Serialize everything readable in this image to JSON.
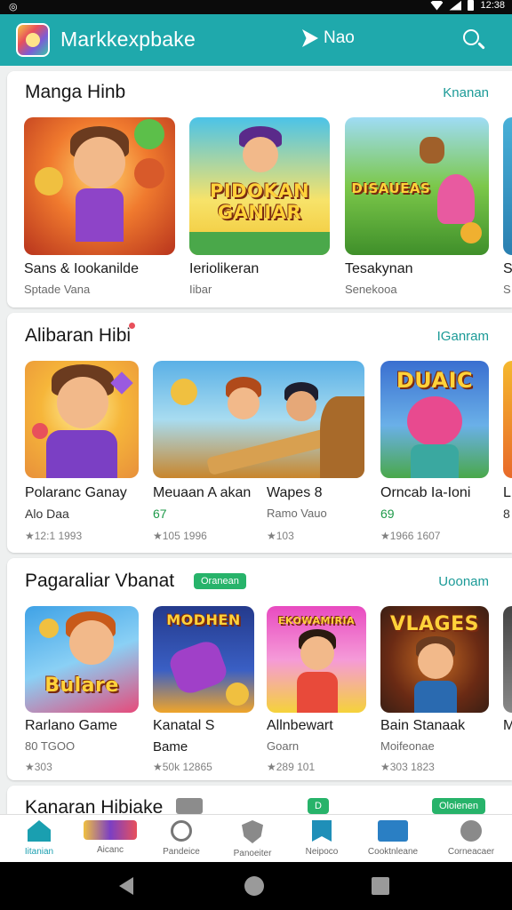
{
  "status_bar": {
    "left_icon": "settings-circle-icon",
    "time": "12:38"
  },
  "app_bar": {
    "title": "Markkexpbake",
    "now_label": "Nao",
    "search_icon": "search-icon",
    "accent": "#1fa9ac"
  },
  "sections": [
    {
      "title": "Manga Hinb",
      "more": "Knanan",
      "items": [
        {
          "name": "Sans & Iookanilde",
          "sub": "Sptade Vana",
          "banner": "",
          "colors": [
            "#f07a2e",
            "#b8341d"
          ]
        },
        {
          "name": "Ieriolikeran",
          "sub": "Iibar",
          "banner": "PIDOKAN GANIAR",
          "colors": [
            "#4bc3e8",
            "#f2c431"
          ]
        },
        {
          "name": "Tesakynan",
          "sub": "Senekooa",
          "banner": "DISAUEAS",
          "colors": [
            "#7cc84a",
            "#3f8f2a"
          ]
        },
        {
          "name": "S",
          "sub": "S",
          "banner": "",
          "colors": [
            "#48b0d8",
            "#2a7fb0"
          ]
        }
      ]
    },
    {
      "title": "Alibaran Hibi",
      "more": "IGanram",
      "items": [
        {
          "name": "Polaranc Ganay",
          "price": "Alo Daa",
          "rating": "★12:1 1993",
          "banner": "",
          "colors": [
            "#f6b63a",
            "#7b3fc4"
          ]
        },
        {
          "name": "Meuaan A akan",
          "price": "67",
          "rating": "★105 1996",
          "banner": "",
          "colors": [
            "#5ab0e6",
            "#c8862c"
          ]
        },
        {
          "name": "Wapes 8",
          "price": "Ramo Vauo",
          "rating": "★103",
          "banner": "",
          "colors": [
            "#5ab0e6",
            "#c8862c"
          ]
        },
        {
          "name": "Orncab Ia-Ioni",
          "price": "69",
          "rating": "★1966 1607",
          "banner": "DUAIC",
          "colors": [
            "#3a6fd0",
            "#e84a8f"
          ]
        },
        {
          "name": "L",
          "price": "8",
          "rating": "",
          "banner": "",
          "colors": [
            "#f5b82e",
            "#e86a2a"
          ]
        }
      ]
    },
    {
      "title": "Pagaraliar Vbanat",
      "chip": "Oranean",
      "more": "Uoonam",
      "items": [
        {
          "name": "Rarlano Game",
          "sub": "80 TGOO",
          "rating": "★303",
          "banner": "Bulare",
          "colors": [
            "#3fa2e6",
            "#e64a7a"
          ]
        },
        {
          "name": "Kanatal S",
          "sub": "Bame",
          "rating": "★50k 12865",
          "banner": "MODHEN",
          "colors": [
            "#243a8c",
            "#f0a52a"
          ]
        },
        {
          "name": "Allnbewart",
          "sub": "Goarn",
          "rating": "★289 101",
          "banner": "EKOWAMIRIA",
          "colors": [
            "#e84ac0",
            "#f5d23a"
          ]
        },
        {
          "name": "Bain Stanaak",
          "sub": "Moifeonae",
          "rating": "★303 1823",
          "banner": "VLAGES",
          "colors": [
            "#3a1f14",
            "#c46a22"
          ]
        },
        {
          "name": "M",
          "sub": "",
          "rating": "",
          "banner": "",
          "colors": [
            "#444",
            "#888"
          ]
        }
      ]
    },
    {
      "title": "Kanaran Hibiake",
      "chip": "D",
      "chip2": "Oloienen"
    }
  ],
  "bottom_nav": [
    {
      "label": "Iitanian",
      "icon": "home-icon",
      "active": true
    },
    {
      "label": "Aicanc",
      "icon": "games-logo-icon",
      "active": false
    },
    {
      "label": "Pandeice",
      "icon": "compass-icon",
      "active": false
    },
    {
      "label": "Panoeiter",
      "icon": "shield-icon",
      "active": false
    },
    {
      "label": "Neipoco",
      "icon": "bookmark-icon",
      "active": false
    },
    {
      "label": "Cooktnleane",
      "icon": "puzzle-icon",
      "active": false
    },
    {
      "label": "Corneacaer",
      "icon": "person-icon",
      "active": false
    }
  ]
}
